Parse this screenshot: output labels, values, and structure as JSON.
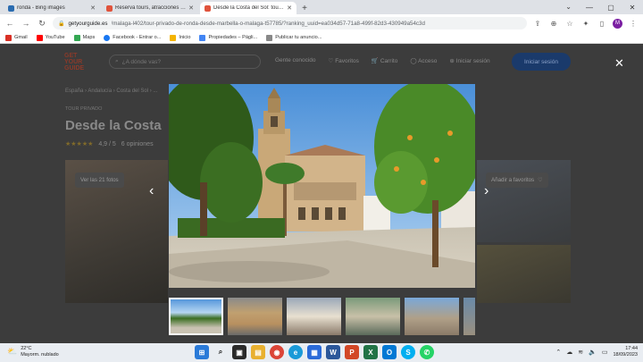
{
  "browser": {
    "tabs": [
      {
        "title": "ronda - Bing images",
        "color": "#2b6cb0",
        "active": false
      },
      {
        "title": "Reserva tours, atracciones y activ...",
        "color": "#e0533c",
        "active": false
      },
      {
        "title": "Desde la Costa del Sol: tour priv...",
        "color": "#e0533c",
        "active": true
      }
    ],
    "new_tab": "+",
    "url_host": "getyourguide.es",
    "url_rest": "/malaga-l402/tour-privado-de-ronda-desde-marbella-o-malaga-t57785/?ranking_uuid=ea034d57-71a8-499f-82d3-430949a54c3d",
    "profile_initial": "M",
    "bookmarks": [
      {
        "label": "Gmail",
        "color": "#d93025"
      },
      {
        "label": "YouTube",
        "color": "#ff0000"
      },
      {
        "label": "Maps",
        "color": "#34a853"
      },
      {
        "label": "Facebook - Entrar o...",
        "color": "#1877f2"
      },
      {
        "label": "Inicio",
        "color": "#f4b400"
      },
      {
        "label": "Propiedades – Págli...",
        "color": "#4285f4"
      },
      {
        "label": "Publicar tu anuncio...",
        "color": "#888888"
      }
    ]
  },
  "site": {
    "logo_lines": [
      "GET",
      "YOUR",
      "GUIDE"
    ],
    "search_placeholder": "¿A dónde vas?",
    "nav": [
      "Gente conocido",
      "Favoritos",
      "Carrito",
      "Acceso",
      "Iniciar sesión"
    ],
    "login": "Iniciar sesión",
    "breadcrumb": "España › Andalucía › Costa del Sol › ...",
    "kicker": "TOUR PRIVADO",
    "title": "Desde la Costa",
    "stars": "★★★★★",
    "rating": "4,9 / 5",
    "reviews": "6 opiniones",
    "see_all": "Ver las 21 fotos",
    "add_fav": "Añadir a favoritos"
  },
  "lightbox": {
    "close": "✕",
    "prev": "‹",
    "next": "›",
    "thumb_count": 6
  },
  "taskbar": {
    "temp": "22°C",
    "weather": "Mayorm. nublado",
    "time": "17:44",
    "date": "18/09/2023",
    "badge": "99+"
  }
}
